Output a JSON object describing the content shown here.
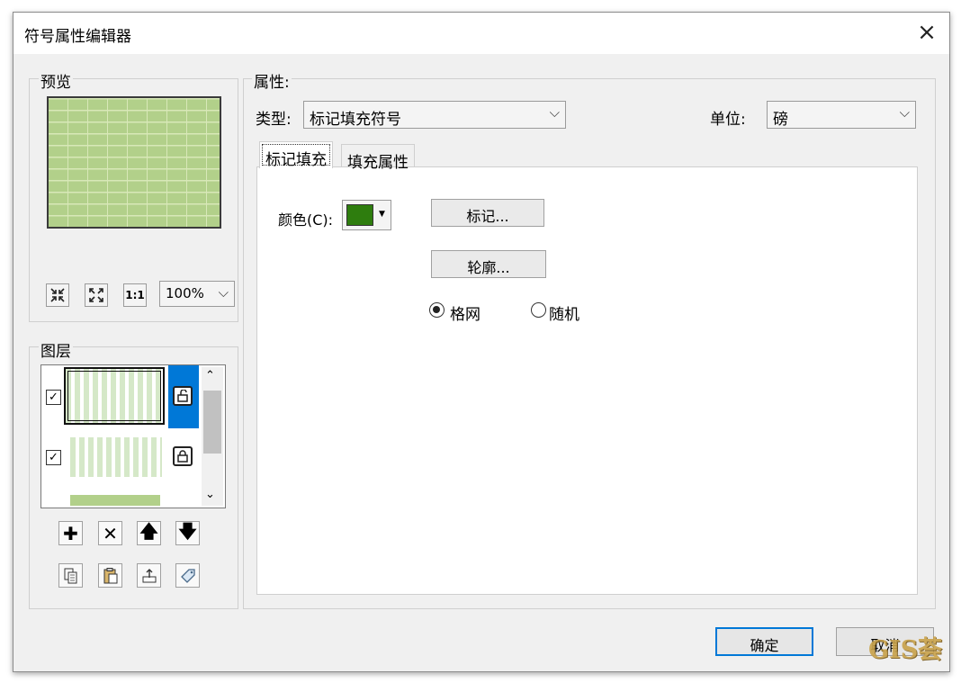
{
  "window": {
    "title": "符号属性编辑器",
    "close_icon": "×"
  },
  "preview": {
    "group_label": "预览",
    "fill_color": "#b2d08a",
    "tools": [
      "zoom-in-icon",
      "zoom-out-icon",
      "actual-size-icon"
    ],
    "actual_size_label": "1:1",
    "zoom_value": "100%"
  },
  "layers": {
    "group_label": "图层",
    "items": [
      {
        "checked": true,
        "selected": true,
        "lock": "unlocked"
      },
      {
        "checked": true,
        "selected": false,
        "lock": "locked"
      }
    ],
    "actions": [
      "add-icon",
      "remove-icon",
      "move-up-icon",
      "move-down-icon"
    ],
    "actions2": [
      "copy-icon",
      "paste-icon",
      "export-icon",
      "tag-icon"
    ]
  },
  "properties": {
    "group_label": "属性:",
    "type_label": "类型:",
    "type_value": "标记填充符号",
    "unit_label": "单位:",
    "unit_value": "磅",
    "tabs": [
      "标记填充",
      "填充属性"
    ],
    "color_label": "颜色(C):",
    "color_value": "#2e7d0e",
    "marker_button": "标记...",
    "outline_button": "轮廓...",
    "radio_grid": "格网",
    "radio_random": "随机",
    "radio_selected": "grid"
  },
  "footer": {
    "ok_label": "确定",
    "cancel_label": "取消"
  },
  "watermark": "GIS荟"
}
